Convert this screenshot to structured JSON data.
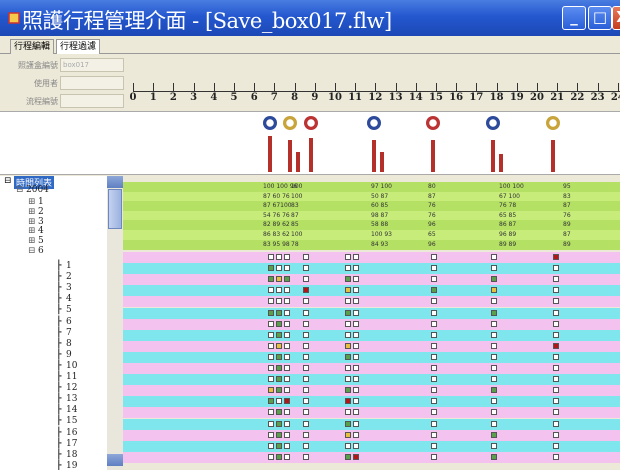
{
  "window": {
    "title": "照護行程管理介面 - [Save_box017.flw]",
    "controls": {
      "minimize": "_",
      "maximize": "□",
      "close": "X"
    }
  },
  "tabs": [
    "行程編輯",
    "行程過濾"
  ],
  "form": {
    "fields": [
      {
        "label": "照護盒編號",
        "value": "box017"
      },
      {
        "label": "使用者",
        "value": ""
      },
      {
        "label": "流程編號",
        "value": ""
      }
    ]
  },
  "ruler": {
    "hours": [
      "0",
      "1",
      "2",
      "3",
      "4",
      "5",
      "6",
      "7",
      "8",
      "9",
      "10",
      "11",
      "12",
      "13",
      "14",
      "15",
      "16",
      "17",
      "18",
      "19",
      "20",
      "21",
      "22",
      "23",
      "24"
    ]
  },
  "pictures": {
    "icons": [
      "meal-icon",
      "pill-icon",
      "exercise-icon",
      "meal-icon",
      "exercise-icon",
      "meal-icon",
      "pill-icon"
    ],
    "colors": {
      "bar": "#b3312a"
    }
  },
  "tree": {
    "root": "時間列表",
    "year": "2004",
    "months": [
      "1",
      "2",
      "3",
      "4",
      "5",
      "6"
    ],
    "days": [
      "1",
      "2",
      "3",
      "4",
      "5",
      "6",
      "7",
      "8",
      "9",
      "10",
      "11",
      "12",
      "13",
      "14",
      "15",
      "16",
      "17",
      "18",
      "19"
    ]
  },
  "grid": {
    "colors": {
      "green": "#b4e064",
      "cyan": "#7fe6ee",
      "pink": "#f4c2ee"
    },
    "summary_rows": [
      [
        "100 100 96",
        "100",
        "97 100",
        "80",
        "100 100",
        "95"
      ],
      [
        "87  60 76",
        "100",
        "50  87",
        "87",
        "67 100",
        "83"
      ],
      [
        "87  67100",
        "83",
        "60  85",
        "76",
        "76  78",
        "87"
      ],
      [
        "54  76 76",
        "87",
        "98  87",
        "76",
        "65  85",
        "76"
      ],
      [
        "82  89 62",
        "85",
        "58  88",
        "96",
        "86  87",
        "89"
      ],
      [
        "86  83 62",
        "100",
        "100 93",
        "65",
        "96  89",
        "87"
      ],
      [
        "83  95 98",
        "78",
        "84  93",
        "96",
        "89  89",
        "89"
      ]
    ],
    "square_colors": {
      "white": "#ffffff",
      "green": "#5aa04a",
      "yellow": "#e8c040",
      "red": "#b01818"
    },
    "detail_rows": [
      [
        "w",
        "w",
        "w",
        "w",
        "w",
        "w",
        "w",
        "w",
        "r"
      ],
      [
        "g",
        "w",
        "w",
        "w",
        "w",
        "w",
        "w",
        "w",
        "w"
      ],
      [
        "g",
        "y",
        "g",
        "w",
        "g",
        "w",
        "w",
        "g",
        "w"
      ],
      [
        "w",
        "w",
        "w",
        "r",
        "y",
        "w",
        "g",
        "y",
        "w"
      ],
      [
        "w",
        "w",
        "w",
        "w",
        "w",
        "w",
        "w",
        "w",
        "w"
      ],
      [
        "g",
        "g",
        "w",
        "w",
        "g",
        "w",
        "w",
        "g",
        "w"
      ],
      [
        "w",
        "g",
        "w",
        "w",
        "w",
        "w",
        "w",
        "w",
        "w"
      ],
      [
        "w",
        "g",
        "w",
        "w",
        "w",
        "w",
        "w",
        "w",
        "w"
      ],
      [
        "w",
        "y",
        "w",
        "w",
        "y",
        "w",
        "w",
        "w",
        "r"
      ],
      [
        "w",
        "g",
        "w",
        "w",
        "g",
        "w",
        "w",
        "w",
        "w"
      ],
      [
        "w",
        "g",
        "w",
        "w",
        "w",
        "w",
        "w",
        "w",
        "w"
      ],
      [
        "w",
        "g",
        "w",
        "w",
        "w",
        "w",
        "w",
        "w",
        "w"
      ],
      [
        "y",
        "g",
        "w",
        "w",
        "g",
        "w",
        "w",
        "g",
        "w"
      ],
      [
        "g",
        "w",
        "r",
        "w",
        "r",
        "w",
        "w",
        "w",
        "w"
      ],
      [
        "w",
        "g",
        "w",
        "w",
        "w",
        "w",
        "w",
        "w",
        "w"
      ],
      [
        "w",
        "g",
        "w",
        "w",
        "g",
        "w",
        "w",
        "w",
        "w"
      ],
      [
        "w",
        "g",
        "w",
        "w",
        "y",
        "w",
        "w",
        "g",
        "w"
      ],
      [
        "w",
        "g",
        "w",
        "w",
        "w",
        "w",
        "w",
        "w",
        "w"
      ],
      [
        "w",
        "g",
        "w",
        "w",
        "g",
        "r",
        "w",
        "g",
        "w"
      ]
    ]
  }
}
